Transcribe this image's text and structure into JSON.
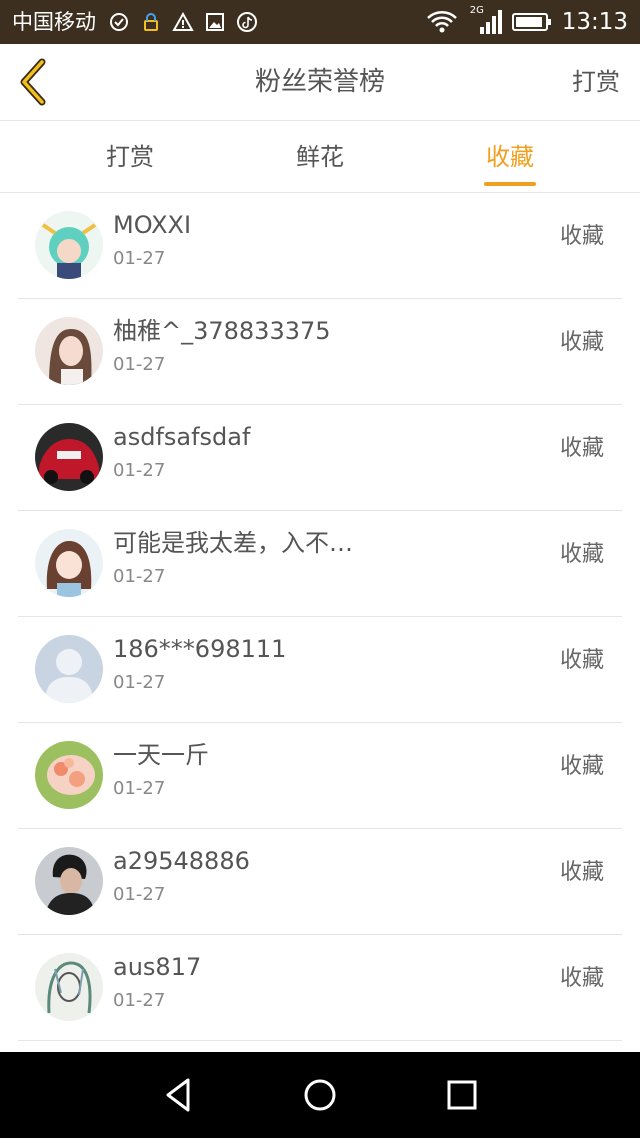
{
  "status_bar": {
    "carrier": "中国移动",
    "network": "2G",
    "time": "13:13",
    "icons": [
      "sync-icon",
      "vpn-lock-icon",
      "alert-icon",
      "image-icon",
      "tiktok-icon",
      "wifi-icon",
      "signal-icon",
      "battery-icon"
    ]
  },
  "header": {
    "back_icon": "chevron-left-icon",
    "title": "粉丝荣誉榜",
    "action": "打赏"
  },
  "tabs": [
    {
      "label": "打赏",
      "active": false
    },
    {
      "label": "鲜花",
      "active": false
    },
    {
      "label": "收藏",
      "active": true
    }
  ],
  "colors": {
    "accent": "#f0a020",
    "status_bar": "#3d2f1f",
    "text": "#555555"
  },
  "fans": [
    {
      "name": "MOXXI",
      "date": "01-27",
      "gift": "收藏"
    },
    {
      "name": "柚稚^_378833375",
      "date": "01-27",
      "gift": "收藏"
    },
    {
      "name": "asdfsafsdaf",
      "date": "01-27",
      "gift": "收藏"
    },
    {
      "name": "可能是我太差，入不…",
      "date": "01-27",
      "gift": "收藏"
    },
    {
      "name": "186***698111",
      "date": "01-27",
      "gift": "收藏"
    },
    {
      "name": "一天一斤",
      "date": "01-27",
      "gift": "收藏"
    },
    {
      "name": "a29548886",
      "date": "01-27",
      "gift": "收藏"
    },
    {
      "name": "aus817",
      "date": "01-27",
      "gift": "收藏"
    }
  ],
  "nav": [
    "back-triangle-icon",
    "home-circle-icon",
    "recents-square-icon"
  ]
}
